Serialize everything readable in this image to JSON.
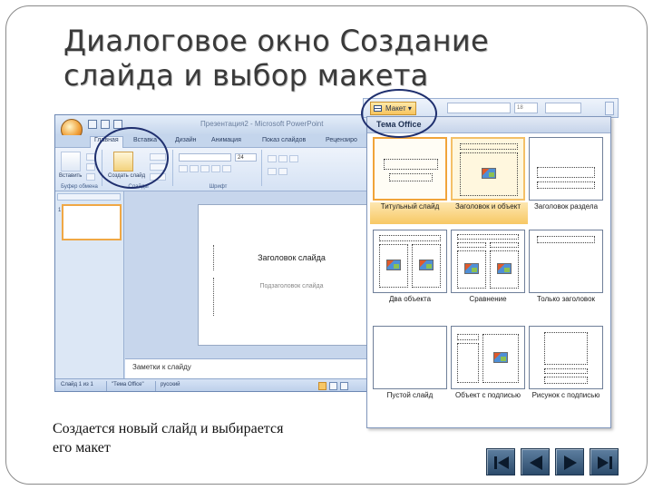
{
  "slide": {
    "title": "Диалоговое окно Создание слайда и выбор макета",
    "caption": "Создается новый слайд и выбирается его макет"
  },
  "ppt": {
    "window_title": "Презентация2 - Microsoft PowerPoint",
    "tabs": [
      "Главная",
      "Вставка",
      "Дизайн",
      "Анимация",
      "Показ слайдов",
      "Рецензиро"
    ],
    "ribbon": {
      "paste_label": "Вставить",
      "new_slide_label": "Создать слайд",
      "group_clipboard": "Буфер обмена",
      "group_slides": "Слайды",
      "group_font": "Шрифт",
      "font_size": "24"
    },
    "slide_placeholder_title": "Заголовок слайда",
    "slide_placeholder_subtitle": "Подзаголовок слайда",
    "notes": "Заметки к слайду",
    "thumbnail_number": "1",
    "status": {
      "slide_info": "Слайд 1 из 1",
      "theme": "\"Тема Office\"",
      "language": "русский"
    }
  },
  "layout_gallery": {
    "button_label": "Макет",
    "size_value": "18",
    "header": "Тема Office",
    "selected": "Титульный слайд",
    "hover": "Заголовок и объект",
    "layouts": [
      "Титульный слайд",
      "Заголовок и объект",
      "Заголовок раздела",
      "Два объекта",
      "Сравнение",
      "Только заголовок",
      "Пустой слайд",
      "Объект с подписью",
      "Рисунок с подписью"
    ]
  },
  "colors": {
    "highlight_circle": "#1f2f6e",
    "selected_tile": "#f1a43a",
    "nav_buttons": "#2c4b6b"
  },
  "icons": [
    "office-button-icon",
    "layout-icon",
    "first-icon",
    "prev-icon",
    "next-icon",
    "last-icon"
  ]
}
